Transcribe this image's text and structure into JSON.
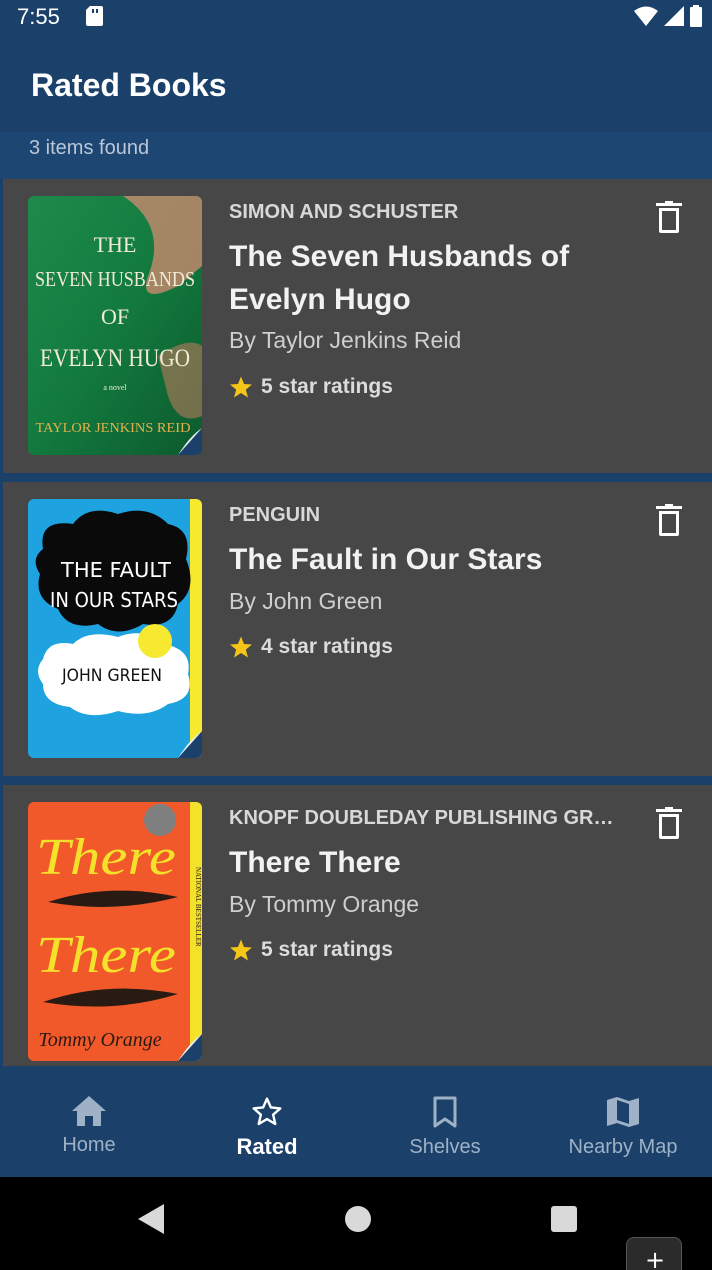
{
  "status_bar": {
    "time": "7:55"
  },
  "app_bar": {
    "title": "Rated Books"
  },
  "results": {
    "count_text": "3 items found"
  },
  "books": [
    {
      "publisher": "SIMON AND SCHUSTER",
      "title": "The Seven Husbands of Evelyn Hugo",
      "author": "By Taylor Jenkins Reid",
      "rating_text": "5 star ratings",
      "cover": {
        "line1": "THE",
        "line2": "SEVEN HUSBANDS",
        "line3": "OF",
        "line4": "EVELYN HUGO",
        "tagline": "a novel",
        "author": "TAYLOR JENKINS REID"
      }
    },
    {
      "publisher": "PENGUIN",
      "title": "The Fault in Our Stars",
      "author": "By John Green",
      "rating_text": "4 star ratings",
      "cover": {
        "line1": "THE FAULT",
        "line2": "IN OUR STARS",
        "author": "JOHN GREEN"
      }
    },
    {
      "publisher": "KNOPF DOUBLEDAY PUBLISHING GROUP",
      "title": "There There",
      "author": "By Tommy Orange",
      "rating_text": "5 star ratings",
      "cover": {
        "line1": "There",
        "line2": "There",
        "author": "Tommy Orange",
        "side": "NATIONAL BESTSELLER"
      }
    }
  ],
  "bottom_nav": [
    {
      "label": "Home",
      "icon": "home-icon"
    },
    {
      "label": "Rated",
      "icon": "star-outline-icon",
      "active": true
    },
    {
      "label": "Shelves",
      "icon": "bookmark-icon"
    },
    {
      "label": "Nearby Map",
      "icon": "map-icon"
    }
  ],
  "colors": {
    "primary": "#1b416b",
    "card": "#474747",
    "star": "#f5c518"
  }
}
